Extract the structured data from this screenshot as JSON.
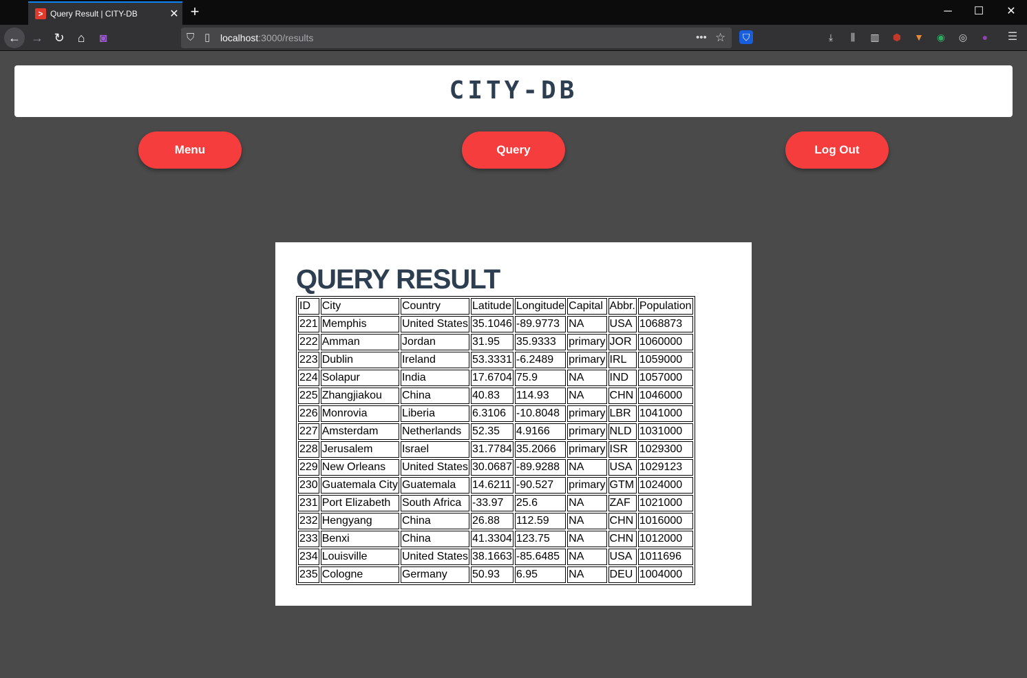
{
  "browser": {
    "tab_title": "Query Result | CITY-DB",
    "url_host": "localhost",
    "url_path": ":3000/results"
  },
  "site": {
    "title": "CITY-DB",
    "nav": {
      "menu": "Menu",
      "query": "Query",
      "logout": "Log Out"
    }
  },
  "result": {
    "heading": "QUERY RESULT",
    "columns": [
      "ID",
      "City",
      "Country",
      "Latitude",
      "Longitude",
      "Capital",
      "Abbr.",
      "Population"
    ],
    "rows": [
      [
        "221",
        "Memphis",
        "United States",
        "35.1046",
        "-89.9773",
        "NA",
        "USA",
        "1068873"
      ],
      [
        "222",
        "Amman",
        "Jordan",
        "31.95",
        "35.9333",
        "primary",
        "JOR",
        "1060000"
      ],
      [
        "223",
        "Dublin",
        "Ireland",
        "53.3331",
        "-6.2489",
        "primary",
        "IRL",
        "1059000"
      ],
      [
        "224",
        "Solapur",
        "India",
        "17.6704",
        "75.9",
        "NA",
        "IND",
        "1057000"
      ],
      [
        "225",
        "Zhangjiakou",
        "China",
        "40.83",
        "114.93",
        "NA",
        "CHN",
        "1046000"
      ],
      [
        "226",
        "Monrovia",
        "Liberia",
        "6.3106",
        "-10.8048",
        "primary",
        "LBR",
        "1041000"
      ],
      [
        "227",
        "Amsterdam",
        "Netherlands",
        "52.35",
        "4.9166",
        "primary",
        "NLD",
        "1031000"
      ],
      [
        "228",
        "Jerusalem",
        "Israel",
        "31.7784",
        "35.2066",
        "primary",
        "ISR",
        "1029300"
      ],
      [
        "229",
        "New Orleans",
        "United States",
        "30.0687",
        "-89.9288",
        "NA",
        "USA",
        "1029123"
      ],
      [
        "230",
        "Guatemala City",
        "Guatemala",
        "14.6211",
        "-90.527",
        "primary",
        "GTM",
        "1024000"
      ],
      [
        "231",
        "Port Elizabeth",
        "South Africa",
        "-33.97",
        "25.6",
        "NA",
        "ZAF",
        "1021000"
      ],
      [
        "232",
        "Hengyang",
        "China",
        "26.88",
        "112.59",
        "NA",
        "CHN",
        "1016000"
      ],
      [
        "233",
        "Benxi",
        "China",
        "41.3304",
        "123.75",
        "NA",
        "CHN",
        "1012000"
      ],
      [
        "234",
        "Louisville",
        "United States",
        "38.1663",
        "-85.6485",
        "NA",
        "USA",
        "1011696"
      ],
      [
        "235",
        "Cologne",
        "Germany",
        "50.93",
        "6.95",
        "NA",
        "DEU",
        "1004000"
      ]
    ]
  },
  "colors": {
    "page_background": "#4a4a4a",
    "accent_button": "#f53d3d",
    "heading_text": "#2c3e50"
  }
}
